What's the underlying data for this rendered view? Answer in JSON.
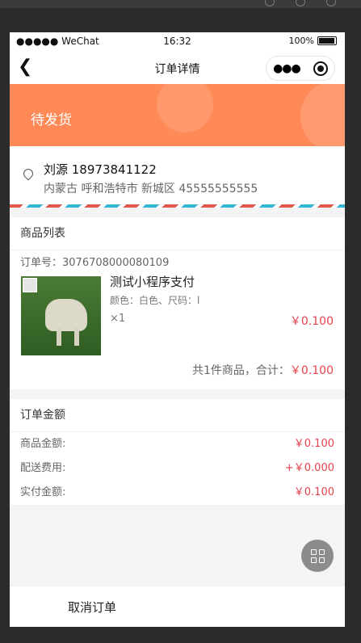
{
  "status_bar": {
    "carrier": "●●●●● WeChat",
    "time": "16:32",
    "battery": "100%"
  },
  "nav": {
    "title": "订单详情",
    "menu_icon": "more-dots-icon",
    "close_icon": "target-icon"
  },
  "banner": {
    "status": "待发货",
    "color": "#ff8a57"
  },
  "address": {
    "name_phone": "刘源 18973841122",
    "detail": "内蒙古 呼和浩特市 新城区 45555555555"
  },
  "products": {
    "section_title": "商品列表",
    "order_no": "订单号：3076708000080109",
    "item": {
      "title": "测试小程序支付",
      "attr": "颜色：白色、尺码：l",
      "qty": "×1",
      "price": "￥0.100"
    },
    "summary_label": "共1件商品，合计：",
    "summary_total": "￥0.100"
  },
  "amount": {
    "section_title": "订单金额",
    "rows": [
      {
        "label": "商品金额:",
        "value": "￥0.100"
      },
      {
        "label": "配送费用:",
        "value": "+￥0.000"
      },
      {
        "label": "实付金额:",
        "value": "￥0.100"
      }
    ]
  },
  "footer": {
    "cancel_label": "取消订单"
  },
  "accent_color": "#e8414e"
}
